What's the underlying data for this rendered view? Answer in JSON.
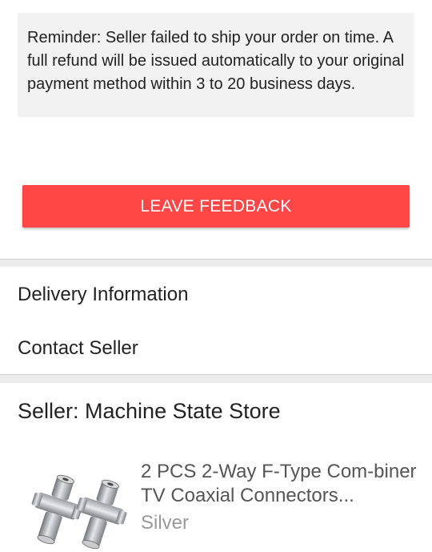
{
  "reminder": {
    "text": "Reminder: Seller failed to ship your order on time. A full refund will be issued automatically to your original payment method within 3 to 20 business days."
  },
  "actions": {
    "leave_feedback_label": "LEAVE FEEDBACK"
  },
  "menu": {
    "items": [
      {
        "label": "Delivery Information"
      },
      {
        "label": "Contact Seller"
      }
    ]
  },
  "seller": {
    "label": "Seller: Machine State Store"
  },
  "product": {
    "title": "2 PCS 2-Way F-Type Com-biner TV Coaxial Connectors...",
    "variant": "Silver",
    "image_icon": "coaxial-connector-image"
  },
  "colors": {
    "accent": "#ff4646",
    "reminder_bg": "#f2f2f2",
    "divider": "#ececec"
  }
}
